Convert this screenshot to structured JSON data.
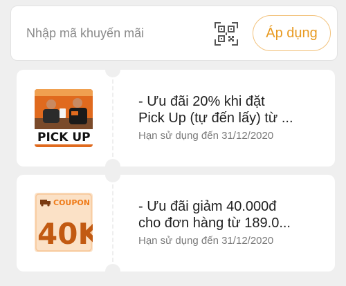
{
  "promo": {
    "placeholder": "Nhập mã khuyến mãi",
    "value": "",
    "qr_icon": "qr-code-icon",
    "apply_label": "Áp dụng",
    "accent": "#e89a20"
  },
  "coupons": [
    {
      "title": "- Ưu đãi 20% khi đặt\nPick Up (tự đến lấy) từ ...",
      "expiry": "Hạn sử dụng đến 31/12/2020",
      "image": {
        "badge_text": "PICK UP"
      }
    },
    {
      "title": "- Ưu đãi giảm 40.000đ\ncho đơn hàng từ 189.0...",
      "expiry": "Hạn sử dụng đến 31/12/2020",
      "image": {
        "badge_text": "COUPON",
        "amount_text": "40K"
      }
    }
  ]
}
